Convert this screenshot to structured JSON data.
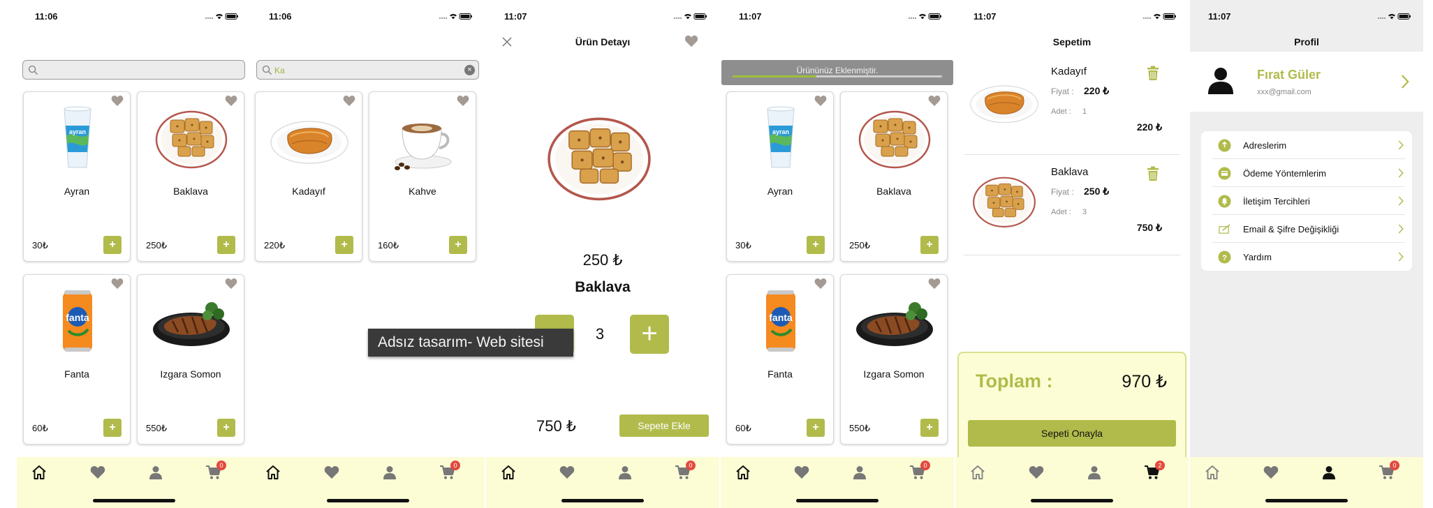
{
  "colors": {
    "accent": "#b1bb4b",
    "tabbar": "#fcfdd5",
    "badge": "#e24a3c",
    "heart": "#a39a94"
  },
  "icons": {
    "status": [
      "signal-icon",
      "wifi-icon",
      "battery-icon"
    ],
    "tabs": [
      "home-icon",
      "heart-icon",
      "user-icon",
      "cart-icon"
    ],
    "card": [
      "heart-icon",
      "plus-icon"
    ]
  },
  "screens": [
    {
      "time": "11:06",
      "search": {
        "value": "",
        "placeholder": ""
      },
      "products": [
        {
          "name": "Ayran",
          "price": "30₺",
          "image": "ayran-cup-icon"
        },
        {
          "name": "Baklava",
          "price": "250₺",
          "image": "baklava-plate-icon"
        },
        {
          "name": "Fanta",
          "price": "60₺",
          "image": "fanta-can-icon"
        },
        {
          "name": "Izgara Somon",
          "price": "550₺",
          "image": "grilled-salmon-icon"
        }
      ],
      "cart_badge": "0",
      "active_tab": "home"
    },
    {
      "time": "11:06",
      "search": {
        "value": "Ka",
        "placeholder": ""
      },
      "products": [
        {
          "name": "Kadayıf",
          "price": "220₺",
          "image": "kadayif-plate-icon"
        },
        {
          "name": "Kahve",
          "price": "160₺",
          "image": "coffee-cup-icon"
        }
      ],
      "cart_badge": "0",
      "active_tab": "home"
    },
    {
      "time": "11:07",
      "title": "Ürün Detayı",
      "price": "250 ₺",
      "name": "Baklava",
      "quantity": "3",
      "total": "750 ₺",
      "add_button": "Sepete Ekle",
      "cart_badge": "0",
      "active_tab": "home"
    },
    {
      "time": "11:07",
      "toast": {
        "message": "Ürününüz Eklenmiştir.",
        "progress": 0.4
      },
      "products": [
        {
          "name": "Ayran",
          "price": "30₺",
          "image": "ayran-cup-icon"
        },
        {
          "name": "Baklava",
          "price": "250₺",
          "image": "baklava-plate-icon"
        },
        {
          "name": "Fanta",
          "price": "60₺",
          "image": "fanta-can-icon"
        },
        {
          "name": "Izgara Somon",
          "price": "550₺",
          "image": "grilled-salmon-icon"
        }
      ],
      "cart_badge": "0",
      "active_tab": "home"
    },
    {
      "time": "11:07",
      "title": "Sepetim",
      "items": [
        {
          "name": "Kadayıf",
          "price_label": "Fiyat :",
          "price": "220 ₺",
          "qty_label": "Adet :",
          "qty": "1",
          "subtotal": "220 ₺"
        },
        {
          "name": "Baklava",
          "price_label": "Fiyat :",
          "price": "250 ₺",
          "qty_label": "Adet :",
          "qty": "3",
          "subtotal": "750 ₺"
        }
      ],
      "total_label": "Toplam :",
      "total": "970 ₺",
      "confirm_button": "Sepeti Onayla",
      "cart_badge": "2",
      "active_tab": "cart"
    },
    {
      "time": "11:07",
      "title": "Profil",
      "user": {
        "name": "Fırat Güler",
        "email": "xxx@gmail.com"
      },
      "menu": [
        {
          "label": "Adreslerim",
          "icon": "location-icon"
        },
        {
          "label": "Ödeme Yöntemlerim",
          "icon": "credit-card-icon"
        },
        {
          "label": "İletişim Tercihleri",
          "icon": "bell-icon"
        },
        {
          "label": "Email & Şifre Değişikliği",
          "icon": "edit-icon"
        },
        {
          "label": "Yardım",
          "icon": "help-icon"
        }
      ],
      "cart_badge": "0",
      "active_tab": "profile"
    }
  ],
  "watermark": "Adsız tasarım- Web sitesi"
}
